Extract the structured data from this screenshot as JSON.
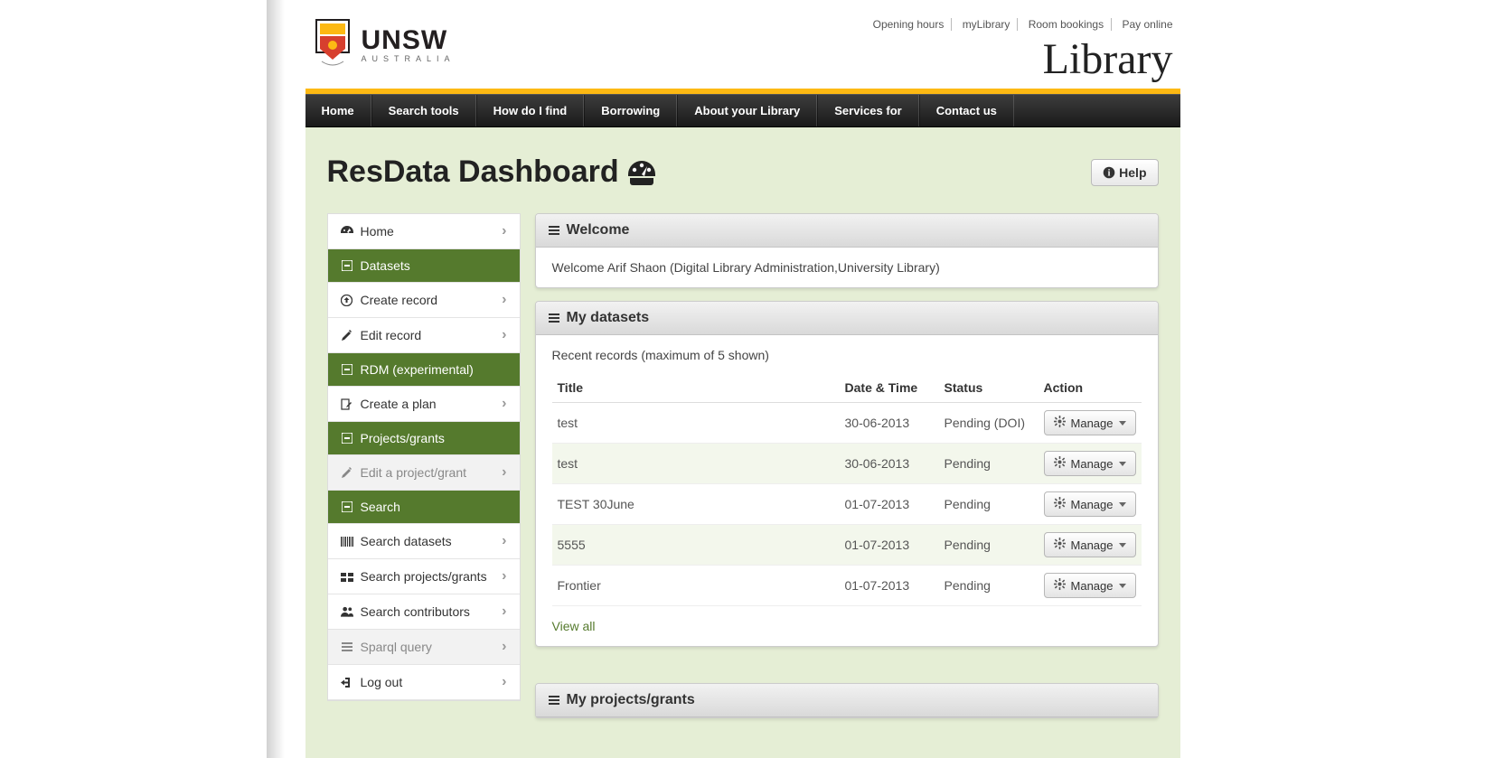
{
  "top_links": [
    "Opening hours",
    "myLibrary",
    "Room bookings",
    "Pay online"
  ],
  "logo": {
    "uni": "UNSW",
    "country": "AUSTRALIA"
  },
  "library_title": "Library",
  "mainnav": [
    "Home",
    "Search tools",
    "How do I find",
    "Borrowing",
    "About your Library",
    "Services for",
    "Contact us"
  ],
  "page_title": "ResData Dashboard",
  "help_label": "Help",
  "sidebar": [
    {
      "kind": "item",
      "icon": "dashboard",
      "label": "Home"
    },
    {
      "kind": "header",
      "icon": "minus-box",
      "label": "Datasets"
    },
    {
      "kind": "item",
      "icon": "upload",
      "label": "Create record"
    },
    {
      "kind": "item",
      "icon": "pencil",
      "label": "Edit record"
    },
    {
      "kind": "header",
      "icon": "minus-box",
      "label": "RDM (experimental)"
    },
    {
      "kind": "item",
      "icon": "edit-doc",
      "label": "Create a plan"
    },
    {
      "kind": "header",
      "icon": "minus-box",
      "label": "Projects/grants"
    },
    {
      "kind": "item",
      "icon": "pencil",
      "label": "Edit a project/grant",
      "disabled": true
    },
    {
      "kind": "header",
      "icon": "minus-box",
      "label": "Search"
    },
    {
      "kind": "item",
      "icon": "barcode",
      "label": "Search datasets"
    },
    {
      "kind": "item",
      "icon": "projects",
      "label": "Search projects/grants"
    },
    {
      "kind": "item",
      "icon": "people",
      "label": "Search contributors"
    },
    {
      "kind": "item",
      "icon": "bars",
      "label": "Sparql query",
      "disabled": true
    },
    {
      "kind": "item",
      "icon": "logout",
      "label": "Log out"
    }
  ],
  "welcome": {
    "title": "Welcome",
    "message": "Welcome Arif Shaon (Digital Library Administration,University Library)"
  },
  "mydatasets": {
    "title": "My datasets",
    "caption": "Recent records (maximum of 5 shown)",
    "columns": [
      "Title",
      "Date & Time",
      "Status",
      "Action"
    ],
    "rows": [
      {
        "title": "test",
        "date": "30-06-2013",
        "status": "Pending (DOI)",
        "link": false
      },
      {
        "title": "test",
        "date": "30-06-2013",
        "status": "Pending",
        "link": false
      },
      {
        "title": "TEST 30June",
        "date": "01-07-2013",
        "status": "Pending",
        "link": true
      },
      {
        "title": "5555",
        "date": "01-07-2013",
        "status": "Pending",
        "link": false
      },
      {
        "title": "Frontier",
        "date": "01-07-2013",
        "status": "Pending",
        "link": false
      }
    ],
    "manage_label": "Manage",
    "view_all": "View all"
  },
  "myprojects": {
    "title": "My projects/grants"
  }
}
